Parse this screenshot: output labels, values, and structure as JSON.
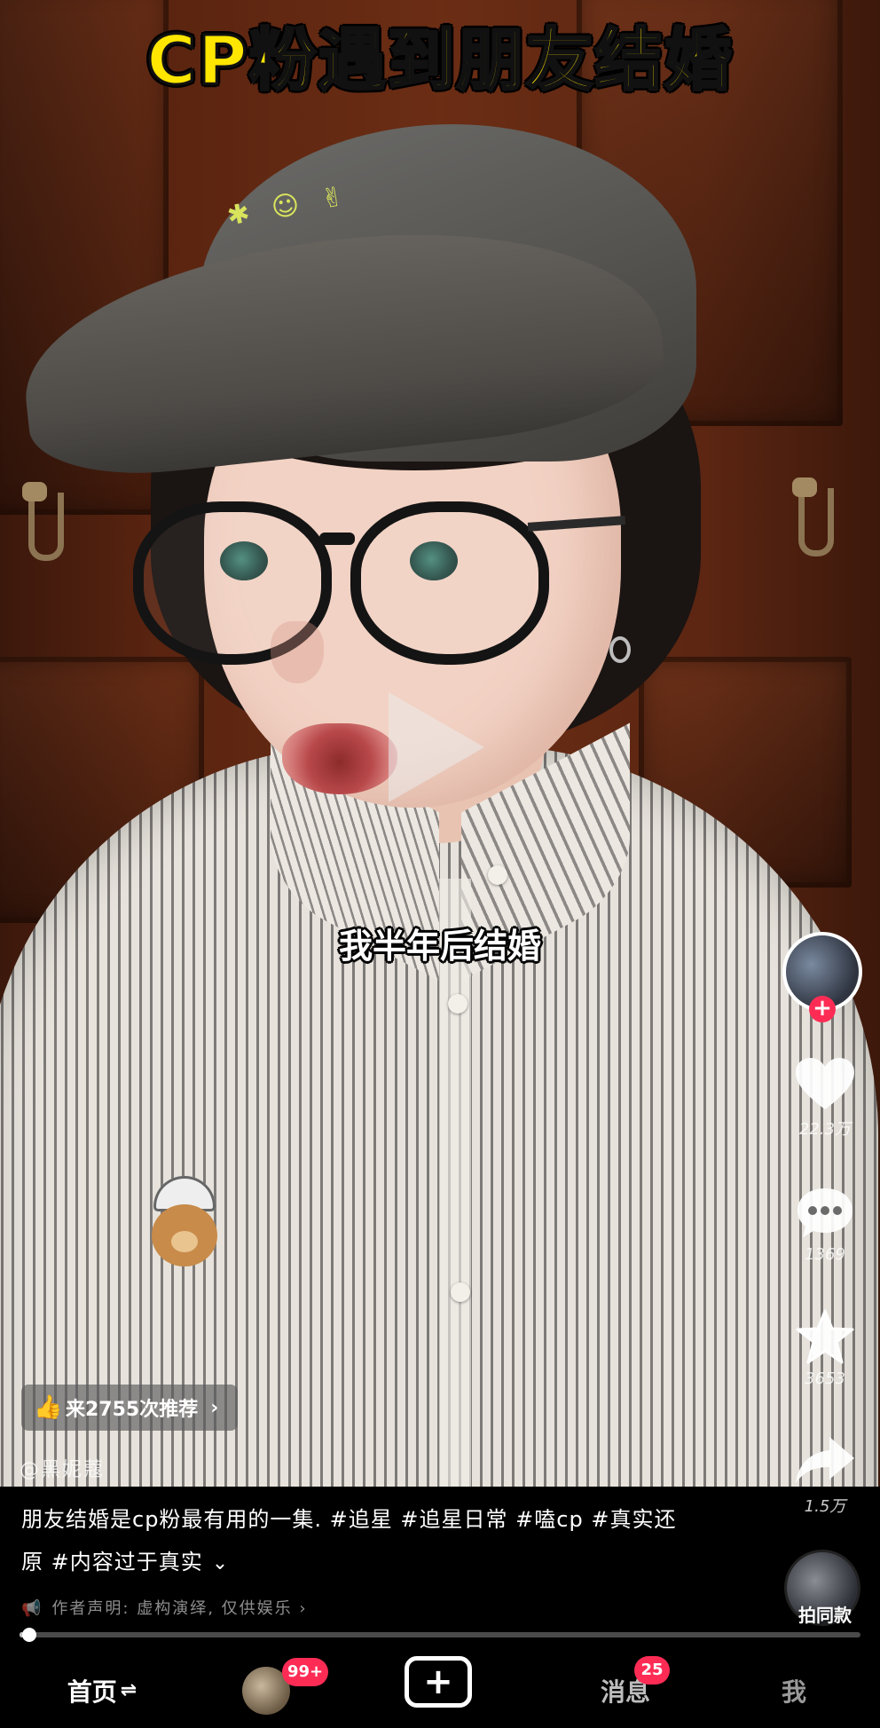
{
  "video": {
    "title_overlay": "CP粉遇到朋友结婚",
    "subtitle": "我半年后结婚",
    "watermark": "@黑妮蔻",
    "recommend_pill": "来2755次推荐",
    "play_icon": "play-icon"
  },
  "actions": {
    "likes": "22.3万",
    "comments": "1369",
    "favorites": "3653",
    "shares": "1.5万"
  },
  "caption": {
    "line1": "朋友结婚是cp粉最有用的一集. #追星 #追星日常 #嗑cp #真实还",
    "line2": "原 #内容过于真实",
    "disclaimer": "作者声明: 虚构演绎, 仅供娱乐"
  },
  "music": {
    "label": "拍同款"
  },
  "progress": {
    "fraction": 0.005
  },
  "nav": {
    "home": "首页",
    "friends_badge": "99+",
    "create": "+",
    "messages": "消息",
    "messages_badge": "25",
    "me": "我"
  },
  "colors": {
    "accent": "#fe2c55",
    "title_yellow": "#ffe600"
  }
}
